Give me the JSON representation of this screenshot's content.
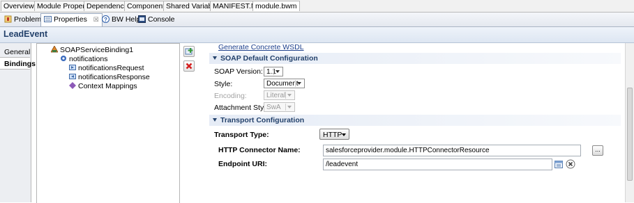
{
  "editor_tabs": [
    "Overview",
    "Module Properties",
    "Dependencies",
    "Components",
    "Shared Variables",
    "MANIFEST.MF",
    "module.bwm"
  ],
  "view_tabs": [
    {
      "label": "Problems",
      "icon": "problems-icon"
    },
    {
      "label": "Properties",
      "icon": "properties-icon",
      "close": "☒"
    },
    {
      "label": "BW Help",
      "icon": "help-icon"
    },
    {
      "label": "Console",
      "icon": "console-icon"
    }
  ],
  "title": "LeadEvent",
  "left_tabs": [
    "General",
    "Bindings"
  ],
  "tree": {
    "binding": "SOAPServiceBinding1",
    "operation": "notifications",
    "request": "notificationsRequest",
    "response": "notificationsResponse",
    "context": "Context Mappings"
  },
  "form": {
    "generate_link": "Generate Concrete WSDL",
    "soap_section": "SOAP Default Configuration",
    "soap_version_label": "SOAP Version:",
    "soap_version_value": "1.1",
    "style_label": "Style:",
    "style_value": "Document",
    "encoding_label": "Encoding:",
    "encoding_value": "Literal",
    "attachment_label": "Attachment Style:",
    "attachment_value": "SwA",
    "transport_section": "Transport Configuration",
    "transport_type_label": "Transport Type:",
    "transport_type_value": "HTTP",
    "http_connector_label": "HTTP Connector Name:",
    "http_connector_value": "salesforceprovider.module.HTTPConnectorResource",
    "browse_label": "...",
    "endpoint_label": "Endpoint URI:",
    "endpoint_value": "/leadevent"
  },
  "colors": {
    "accent": "#23416b",
    "link": "#1c3f8c",
    "delete_red": "#d42020",
    "add_green": "#3b9c3b"
  }
}
